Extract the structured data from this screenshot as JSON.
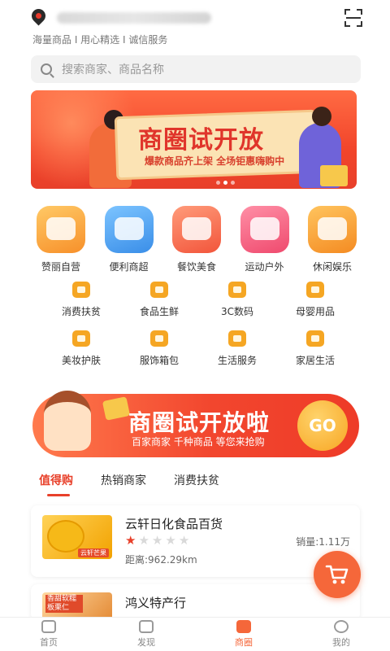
{
  "header": {
    "slogan": "海量商品 I 用心精选 I 诚信服务",
    "search_placeholder": "搜索商家、商品名称"
  },
  "banner": {
    "title": "商圈试开放",
    "subtitle": "爆款商品齐上架 全场钜惠嗨购中"
  },
  "categories": [
    {
      "label": "赞丽自营",
      "color": "#f9a63a"
    },
    {
      "label": "便利商超",
      "color": "#4aa3f0"
    },
    {
      "label": "餐饮美食",
      "color": "#f7765c"
    },
    {
      "label": "运动户外",
      "color": "#f45d7e"
    },
    {
      "label": "休闲娱乐",
      "color": "#f7a33b"
    }
  ],
  "grid": [
    {
      "label": "消费扶贫"
    },
    {
      "label": "食品生鲜"
    },
    {
      "label": "3C数码"
    },
    {
      "label": "母婴用品"
    },
    {
      "label": "美妆护肤"
    },
    {
      "label": "服饰箱包"
    },
    {
      "label": "生活服务"
    },
    {
      "label": "家居生活"
    }
  ],
  "promo": {
    "title": "商圈试开放啦",
    "subtitle": "百家商家 千种商品 等您来抢购",
    "go_label": "GO"
  },
  "tabs": [
    {
      "label": "值得购",
      "active": true
    },
    {
      "label": "热销商家",
      "active": false
    },
    {
      "label": "消费扶贫",
      "active": false
    }
  ],
  "shops": [
    {
      "name": "云轩日化食品百货",
      "rating": 1,
      "sales": "销量:1.11万",
      "distance": "距离:962.29km",
      "thumb_tag": "云轩芒果"
    },
    {
      "name": "鸿义特产行",
      "thumb_tag": "香甜软糯 板栗仁"
    }
  ],
  "nav": [
    {
      "label": "首页",
      "active": false
    },
    {
      "label": "发现",
      "active": false
    },
    {
      "label": "商圈",
      "active": true
    },
    {
      "label": "我的",
      "active": false
    }
  ],
  "colors": {
    "accent": "#e8402a",
    "fab": "#f5673a"
  }
}
